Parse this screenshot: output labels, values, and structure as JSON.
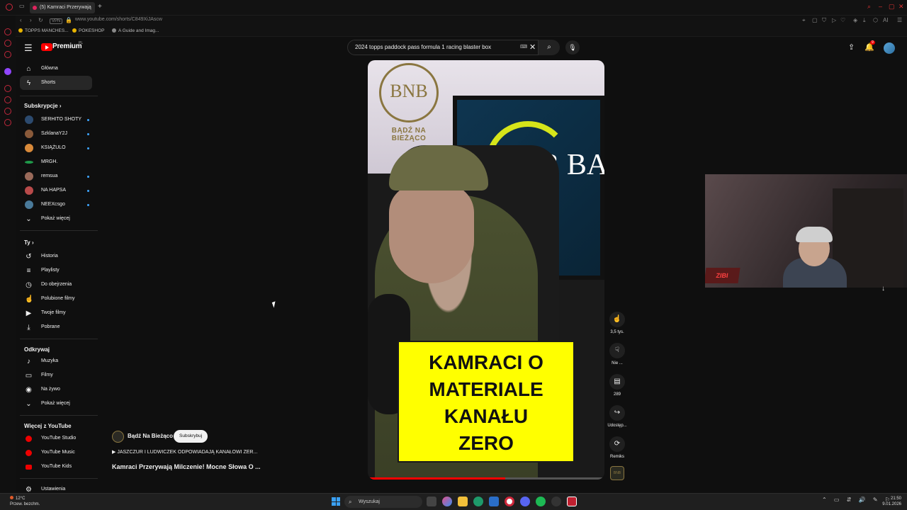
{
  "browser": {
    "tab_title": "(5) Kamraci Przerywają",
    "new_tab": "+",
    "url": "www.youtube.com/shorts/C849XiJAscw",
    "bookmarks": [
      "TOPPS MANCHES...",
      "POKESHOP",
      "A Guide and Imag..."
    ],
    "ai_label": "AI"
  },
  "youtube": {
    "logo_text": "Premium",
    "logo_region": "PL",
    "search_query": "2024 topps paddock pass formula 1 racing blaster box",
    "notification_count": "9"
  },
  "sidebar": {
    "main": [
      {
        "label": "Główna",
        "icon": "home-icon",
        "glyph": "⌂"
      },
      {
        "label": "Shorts",
        "icon": "shorts-icon",
        "glyph": "⚡",
        "active": true
      }
    ],
    "subscriptions_header": "Subskrypcje",
    "subscriptions": [
      {
        "label": "SERHITO SHOTY",
        "color": "#2c4a6e"
      },
      {
        "label": "SzklanaY2J",
        "color": "#8a5a3a"
      },
      {
        "label": "KSIĄŻULO",
        "color": "#d98a3a"
      },
      {
        "label": "MRGH.",
        "color": "#1f9a4a"
      },
      {
        "label": "remsua",
        "color": "#9a6a5a"
      },
      {
        "label": "NA HAPSA",
        "color": "#b84a4a"
      },
      {
        "label": "NEEXcsgo",
        "color": "#4a7a9a"
      }
    ],
    "show_more": "Pokaż więcej",
    "you_header": "Ty",
    "you": [
      {
        "label": "Historia",
        "icon": "history-icon",
        "glyph": "↺"
      },
      {
        "label": "Playlisty",
        "icon": "playlist-icon",
        "glyph": "≡"
      },
      {
        "label": "Do obejrzenia",
        "icon": "watch-later-icon",
        "glyph": "◷"
      },
      {
        "label": "Polubione filmy",
        "icon": "like-icon",
        "glyph": "👍"
      },
      {
        "label": "Twoje filmy",
        "icon": "your-videos-icon",
        "glyph": "▶"
      },
      {
        "label": "Pobrane",
        "icon": "download-icon",
        "glyph": "⤓"
      }
    ],
    "explore_header": "Odkrywaj",
    "explore": [
      {
        "label": "Muzyka",
        "icon": "music-icon",
        "glyph": "♪"
      },
      {
        "label": "Filmy",
        "icon": "film-icon",
        "glyph": "▭"
      },
      {
        "label": "Na żywo",
        "icon": "live-icon",
        "glyph": "◉"
      },
      {
        "label": "Pokaż więcej",
        "icon": "chevron-down-icon",
        "glyph": "⌄"
      }
    ],
    "more_header": "Więcej z YouTube",
    "more": [
      {
        "label": "YouTube Studio",
        "icon": "youtube-studio-icon"
      },
      {
        "label": "YouTube Music",
        "icon": "youtube-music-icon"
      },
      {
        "label": "YouTube Kids",
        "icon": "youtube-kids-icon"
      }
    ],
    "settings": "Ustawienia"
  },
  "short": {
    "logo_text": "BNB",
    "logo_subtitle": "BĄDŹ NA BIEŻĄCO",
    "screen_text": "BNB BA",
    "caption": [
      "KAMRACI O",
      "MATERIALE",
      "KANAŁU",
      "ZERO"
    ],
    "progress": 0.58,
    "channel": "Bądź Na Bieżąco",
    "subscribe": "Subskrybuj",
    "playlist": "▶  JASZCZUR I LUDWICZEK ODPOWIADAJĄ KANAŁOWI ZER...",
    "title": "Kamraci Przerywają Milczenie! Mocne Słowa O ...",
    "channel_thumb": "BNB"
  },
  "actions": [
    {
      "label": "3,5 tys.",
      "icon": "like-icon",
      "glyph": "👍"
    },
    {
      "label": "Nie ...",
      "icon": "dislike-icon",
      "glyph": "👎"
    },
    {
      "label": "289",
      "icon": "comment-icon",
      "glyph": "▤"
    },
    {
      "label": "Udostęp...",
      "icon": "share-icon",
      "glyph": "↪"
    },
    {
      "label": "Remiks",
      "icon": "remix-icon",
      "glyph": "⟳"
    }
  ],
  "cam": {
    "sign_text": "ZIBI"
  },
  "taskbar": {
    "temp": "12°C",
    "weather": "Przew. bezchm.",
    "search_placeholder": "Wyszukaj",
    "time": "21:50",
    "date": "9.01.2026"
  }
}
